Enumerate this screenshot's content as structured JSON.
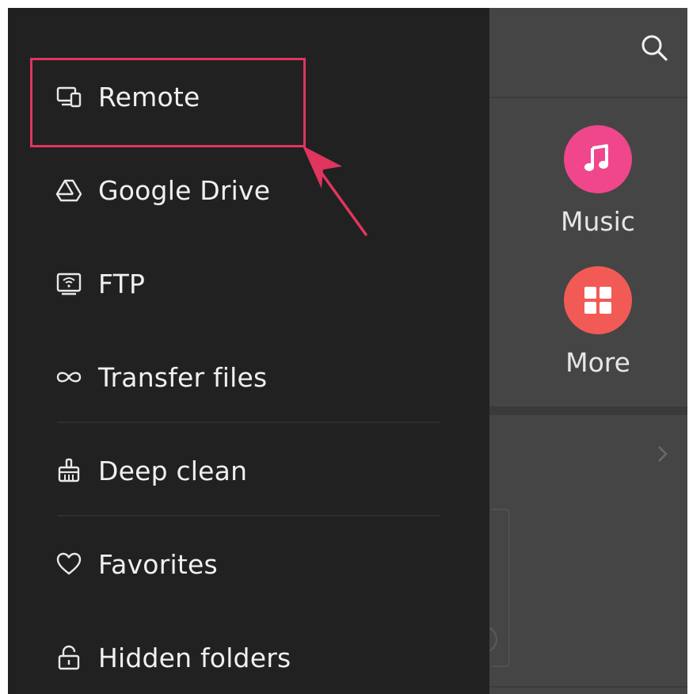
{
  "drawer": {
    "items": [
      {
        "label": "Remote",
        "icon": "remote-devices-icon"
      },
      {
        "label": "Google Drive",
        "icon": "google-drive-icon"
      },
      {
        "label": "FTP",
        "icon": "ftp-icon"
      },
      {
        "label": "Transfer files",
        "icon": "transfer-infinity-icon"
      },
      {
        "label": "Deep clean",
        "icon": "broom-icon"
      },
      {
        "label": "Favorites",
        "icon": "heart-icon"
      },
      {
        "label": "Hidden folders",
        "icon": "lock-icon"
      }
    ]
  },
  "background": {
    "categories": [
      {
        "label": "Music",
        "color": "#f0468c",
        "icon": "music-note-icon"
      },
      {
        "label": "More",
        "color": "#f25a56",
        "icon": "grid-icon"
      }
    ]
  },
  "annotation": {
    "color": "#e0355f"
  }
}
